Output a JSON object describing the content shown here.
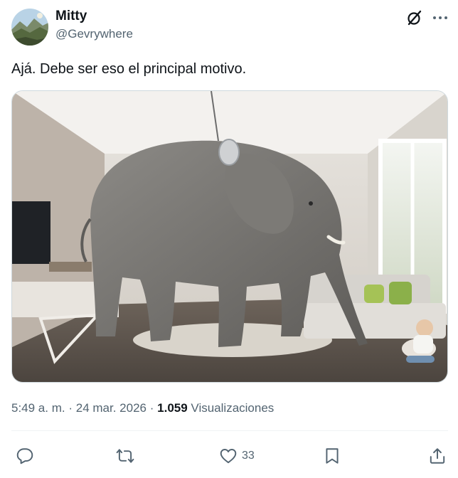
{
  "author": {
    "display_name": "Mitty",
    "handle": "@Gevrywhere",
    "avatar_icon": "mountain-landscape-avatar"
  },
  "header_icons": {
    "grok": "grok-slash-circle-icon",
    "more": "more-dots-icon"
  },
  "tweet": {
    "text": "Ajá. Debe ser eso el principal motivo.",
    "media_description_icon": "elephant-in-living-room-image"
  },
  "meta": {
    "time": "5:49 a. m.",
    "separator": "·",
    "date": "24 mar. 2026",
    "views_count": "1.059",
    "views_label": "Visualizaciones"
  },
  "actions": {
    "reply_count": "",
    "retweet_count": "",
    "like_count": "33",
    "bookmark_count": ""
  },
  "colors": {
    "primary_text": "#0f1419",
    "secondary_text": "#536471",
    "divider": "#eff3f4"
  }
}
